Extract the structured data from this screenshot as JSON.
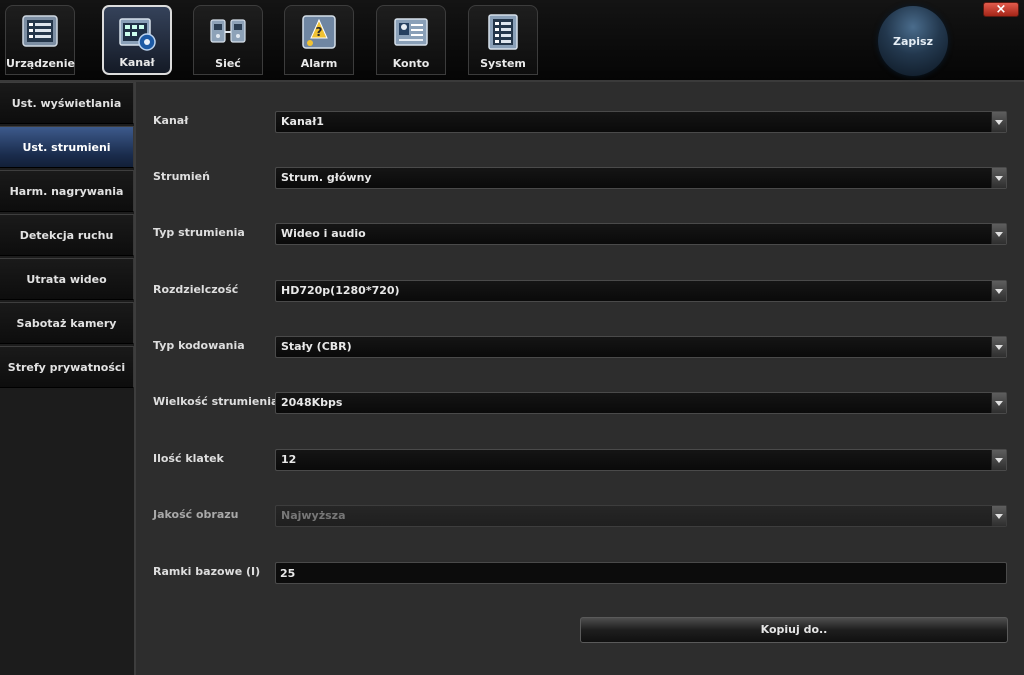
{
  "topbar": {
    "tabs": [
      {
        "label": "Urządzenie",
        "icon": "device-list-icon"
      },
      {
        "label": "Kanał",
        "icon": "video-channel-icon"
      },
      {
        "label": "Sieć",
        "icon": "network-icon"
      },
      {
        "label": "Alarm",
        "icon": "alarm-icon"
      },
      {
        "label": "Konto",
        "icon": "account-icon"
      },
      {
        "label": "System",
        "icon": "system-icon"
      }
    ],
    "active_tab": "Kanał",
    "save_label": "Zapisz",
    "close_label": "×"
  },
  "sidebar": {
    "items": [
      {
        "label": "Ust. wyświetlania"
      },
      {
        "label": "Ust. strumieni"
      },
      {
        "label": "Harm. nagrywania"
      },
      {
        "label": "Detekcja ruchu"
      },
      {
        "label": "Utrata wideo"
      },
      {
        "label": "Sabotaż kamery"
      },
      {
        "label": "Strefy prywatności"
      }
    ],
    "active_item": "Ust. strumieni"
  },
  "form": {
    "fields": [
      {
        "label": "Kanał",
        "value": "Kanał1"
      },
      {
        "label": "Strumień",
        "value": "Strum. główny"
      },
      {
        "label": "Typ strumienia",
        "value": "Wideo i audio"
      },
      {
        "label": "Rozdzielczość",
        "value": "HD720p(1280*720)"
      },
      {
        "label": "Typ kodowania",
        "value": "Stały (CBR)"
      },
      {
        "label": "Wielkość strumienia",
        "value": "2048Kbps"
      },
      {
        "label": "Ilość klatek",
        "value": "12"
      },
      {
        "label": "Jakość obrazu",
        "value": "Najwyższa"
      },
      {
        "label": "Ramki bazowe (I)",
        "value": "25"
      }
    ],
    "copy_label": "Kopiuj do.."
  },
  "colors": {
    "accent": "#3d5a8c",
    "background": "#2b2b2b",
    "close": "#c43a2a"
  }
}
